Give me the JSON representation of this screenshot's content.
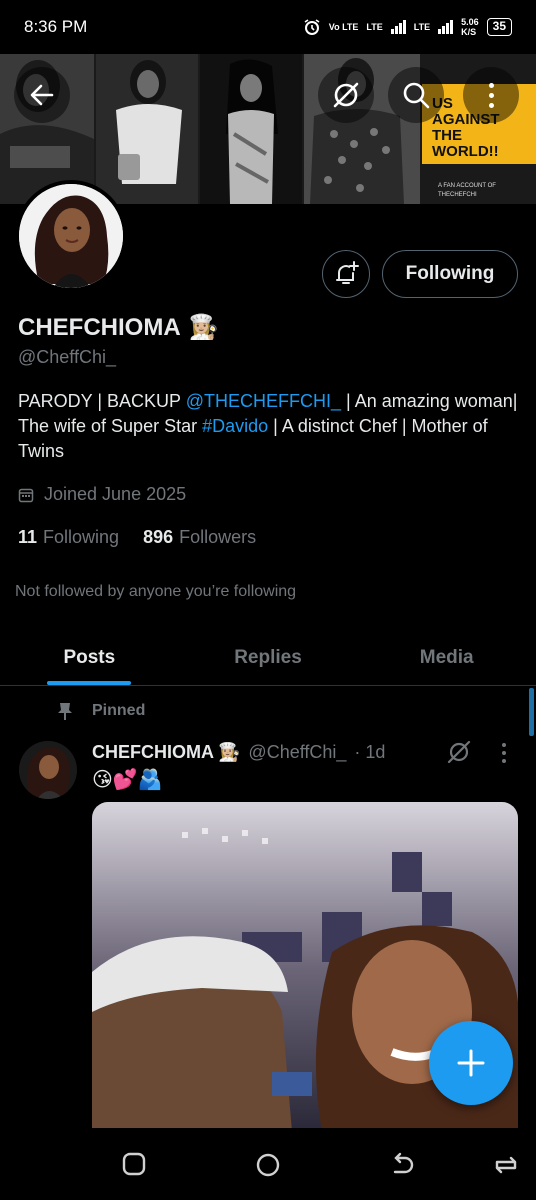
{
  "status_bar": {
    "time": "8:36 PM",
    "network_1": "Vo LTE",
    "network_2": "LTE",
    "network_3": "LTE",
    "speed_value": "5.06",
    "speed_unit": "K/S",
    "battery": "35"
  },
  "banner": {
    "lines": [
      "US",
      "AGAINST",
      "THE",
      "WORLD!!"
    ],
    "sub": [
      "A FAN ACCOUNT OF",
      "THECHEFCHI"
    ]
  },
  "profile": {
    "name": "CHEFCHIOMA",
    "name_emoji": "👩🏼‍🍳",
    "handle": "@CheffChi_",
    "bio_1": "PARODY | BACKUP ",
    "bio_mention": "@THECHEFFCHI_",
    "bio_2": " | An amazing woman| The wife of Super Star ",
    "bio_hashtag": "#Davido",
    "bio_3": " | A distinct Chef | Mother of Twins",
    "joined": "Joined June 2025",
    "following_count": "11",
    "following_label": "Following",
    "followers_count": "896",
    "followers_label": "Followers",
    "not_followed": "Not followed by anyone you’re following",
    "follow_button": "Following"
  },
  "tabs": [
    {
      "label": "Posts",
      "active": true
    },
    {
      "label": "Replies",
      "active": false
    },
    {
      "label": "Media",
      "active": false
    }
  ],
  "post": {
    "pinned_label": "Pinned",
    "author_name": "CHEFCHIOMA",
    "author_emoji": "👩🏼‍🍳",
    "author_handle": "@CheffChi_",
    "time": "· 1d",
    "text": "😘💕🫂"
  },
  "colors": {
    "accent": "#1d9bf0",
    "muted": "#71767b",
    "text": "#e7e9ea",
    "banner_yellow": "#f2b417"
  },
  "icons": [
    "back-arrow-icon",
    "grok-icon",
    "search-icon",
    "more-vertical-icon",
    "bell-plus-icon",
    "calendar-icon",
    "pin-icon",
    "plus-icon",
    "recent-apps-icon",
    "home-circle-icon",
    "back-nav-icon",
    "rotate-icon"
  ]
}
